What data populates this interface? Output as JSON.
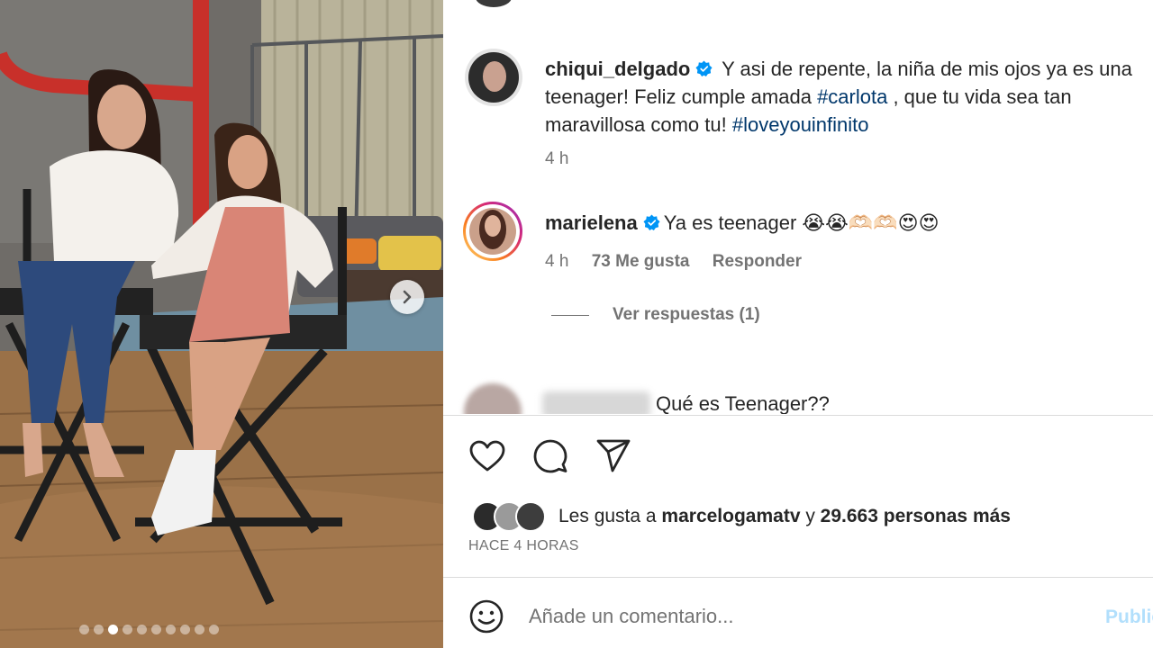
{
  "post": {
    "carousel": {
      "total_slides": 10,
      "active_index": 2
    },
    "caption": {
      "username": "chiqui_delgado",
      "text_before": " Y asi de repente, la niña de mis ojos ya es una teenager! Feliz cumple amada ",
      "hashtag1": "#carlota",
      "text_middle": " , que tu vida sea tan maravillosa como tu! ",
      "hashtag2": "#loveyouinfinito",
      "time": "4 h"
    },
    "comment1": {
      "username": "marielena",
      "text": "Ya es teenager 😭😭🫶🏻🫶🏻😍😍",
      "time": "4 h",
      "likes": "73 Me gusta",
      "reply": "Responder",
      "view_replies": "Ver respuestas (1)"
    },
    "comment2": {
      "text": "Qué es Teenager??"
    },
    "likes": {
      "prefix": "Les gusta a ",
      "user": "marcelogamatv",
      "middle": " y ",
      "count": "29.663 personas más"
    },
    "timestamp": "HACE 4 HORAS",
    "add_comment_placeholder": "Añade un comentario...",
    "publish_label": "Publicar"
  },
  "colors": {
    "link": "#00376b",
    "verified": "#0095f6",
    "muted": "#737373",
    "publish_disabled": "#b2dffc"
  },
  "icons": [
    "verified-badge-icon",
    "heart-icon",
    "comment-icon",
    "share-icon",
    "emoji-icon",
    "chevron-right-icon"
  ]
}
